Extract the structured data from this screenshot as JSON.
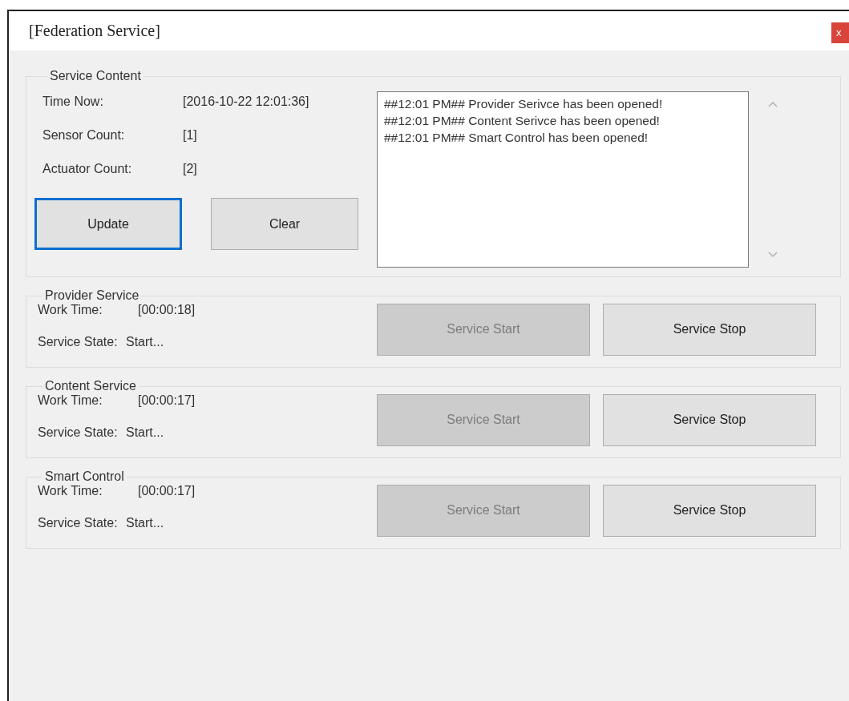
{
  "window": {
    "title": "[Federation Service]",
    "close_label": "x"
  },
  "service_content": {
    "title": "Service Content",
    "fields": [
      {
        "label": "Time Now:",
        "value": "[2016-10-22 12:01:36]"
      },
      {
        "label": "Sensor Count:",
        "value": "[1]"
      },
      {
        "label": "Actuator Count:",
        "value": "[2]"
      }
    ],
    "buttons": [
      {
        "label": "Update",
        "focused": true
      },
      {
        "label": "Clear",
        "focused": false
      }
    ],
    "log": [
      "##12:01 PM## Provider Serivce has been opened!",
      "##12:01 PM## Content Serivce has been opened!",
      "##12:01 PM## Smart Control has been opened!"
    ]
  },
  "services": [
    {
      "title": "Provider Service",
      "work_time_label": "Work Time:",
      "work_time": "[00:00:18]",
      "state_label": "Service State:",
      "state": "Start...",
      "buttons": [
        {
          "label": "Service Start",
          "disabled": true
        },
        {
          "label": "Service Stop",
          "disabled": false
        }
      ]
    },
    {
      "title": "Content Service",
      "work_time_label": "Work Time:",
      "work_time": "[00:00:17]",
      "state_label": "Service State:",
      "state": "Start...",
      "buttons": [
        {
          "label": "Service Start",
          "disabled": true
        },
        {
          "label": "Service Stop",
          "disabled": false
        }
      ]
    },
    {
      "title": "Smart Control",
      "work_time_label": "Work Time:",
      "work_time": "[00:00:17]",
      "state_label": "Service State:",
      "state": "Start...",
      "buttons": [
        {
          "label": "Service Start",
          "disabled": true
        },
        {
          "label": "Service Stop",
          "disabled": false
        }
      ]
    }
  ]
}
